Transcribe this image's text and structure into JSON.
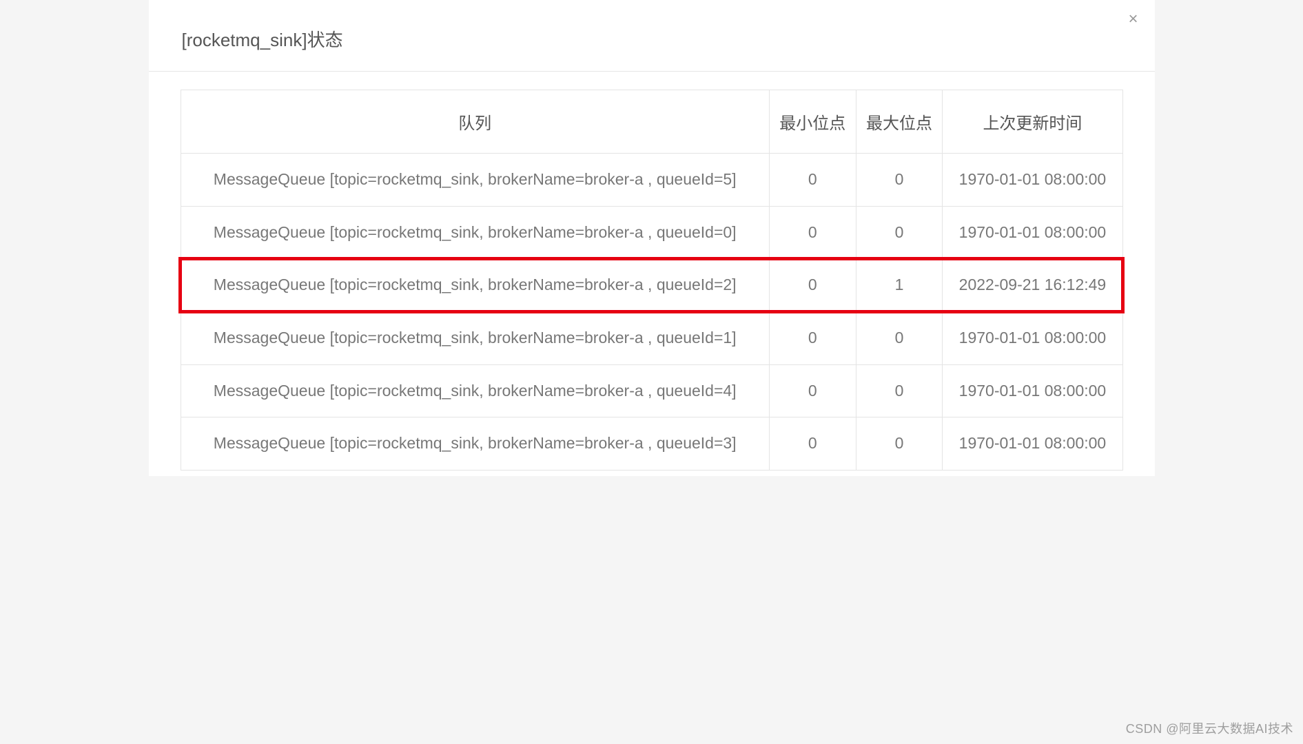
{
  "modal": {
    "title": "[rocketmq_sink]状态"
  },
  "table": {
    "headers": {
      "queue": "队列",
      "min_offset": "最小位点",
      "max_offset": "最大位点",
      "last_update": "上次更新时间"
    },
    "rows": [
      {
        "queue": "MessageQueue [topic=rocketmq_sink, brokerName=broker-a , queueId=5]",
        "min": "0",
        "max": "0",
        "time": "1970-01-01 08:00:00",
        "highlight": false
      },
      {
        "queue": "MessageQueue [topic=rocketmq_sink, brokerName=broker-a , queueId=0]",
        "min": "0",
        "max": "0",
        "time": "1970-01-01 08:00:00",
        "highlight": false
      },
      {
        "queue": "MessageQueue [topic=rocketmq_sink, brokerName=broker-a , queueId=2]",
        "min": "0",
        "max": "1",
        "time": "2022-09-21 16:12:49",
        "highlight": true
      },
      {
        "queue": "MessageQueue [topic=rocketmq_sink, brokerName=broker-a , queueId=1]",
        "min": "0",
        "max": "0",
        "time": "1970-01-01 08:00:00",
        "highlight": false
      },
      {
        "queue": "MessageQueue [topic=rocketmq_sink, brokerName=broker-a , queueId=4]",
        "min": "0",
        "max": "0",
        "time": "1970-01-01 08:00:00",
        "highlight": false
      },
      {
        "queue": "MessageQueue [topic=rocketmq_sink, brokerName=broker-a , queueId=3]",
        "min": "0",
        "max": "0",
        "time": "1970-01-01 08:00:00",
        "highlight": false
      }
    ]
  },
  "watermark": "CSDN @阿里云大数据AI技术"
}
